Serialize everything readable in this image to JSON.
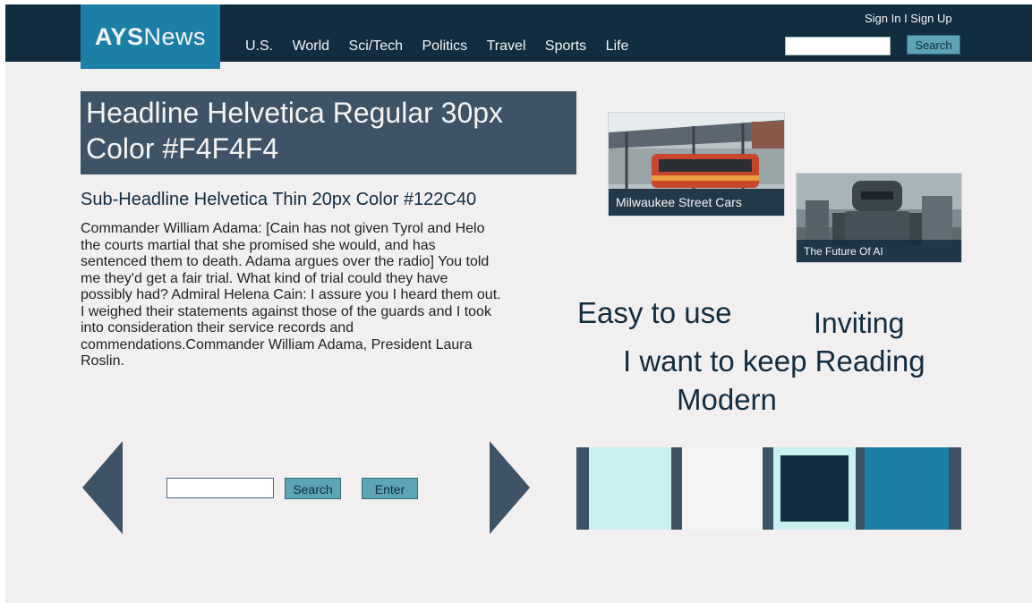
{
  "logo": {
    "bold": "AYS",
    "light": "News"
  },
  "nav": {
    "items": [
      "U.S.",
      "World",
      "Sci/Tech",
      "Politics",
      "Travel",
      "Sports",
      "Life"
    ]
  },
  "auth": {
    "text": "Sign In I Sign Up"
  },
  "top_search": {
    "button_label": "Search",
    "value": ""
  },
  "article": {
    "headline": "Headline Helvetica Regular 30px Color #F4F4F4",
    "subheadline": "Sub-Headline Helvetica Thin 20px Color #122C40",
    "body": "Commander William Adama: [Cain has not given Tyrol and Helo the courts martial that she promised she would, and has sentenced them to death. Adama argues over the radio] You told me they'd get a fair trial. What kind of trial could they have possibly had? Admiral Helena Cain: I assure you I heard them out. I weighed their statements against those of the guards and I took into consideration their service records and commendations.Commander William Adama, President Laura Roslin."
  },
  "features": [
    {
      "caption": "Milwaukee Street Cars"
    },
    {
      "caption": "The Future Of AI"
    }
  ],
  "taglines": [
    "Easy to use",
    "Inviting",
    "I want to keep Reading",
    "Modern"
  ],
  "carousel": {
    "search_label": "Search",
    "enter_label": "Enter",
    "value": ""
  },
  "palette": {
    "frame": "#3e5466",
    "swatches": [
      "#c9efef",
      "#f4f4f4",
      "#122c40",
      "#1c7fa6"
    ],
    "swatch3_surround": "#c9efef"
  },
  "colors": {
    "bar": "#122c40",
    "accent": "#1c7fa6",
    "headline_bg": "#3e5466",
    "page_bg": "#f2eff0"
  }
}
